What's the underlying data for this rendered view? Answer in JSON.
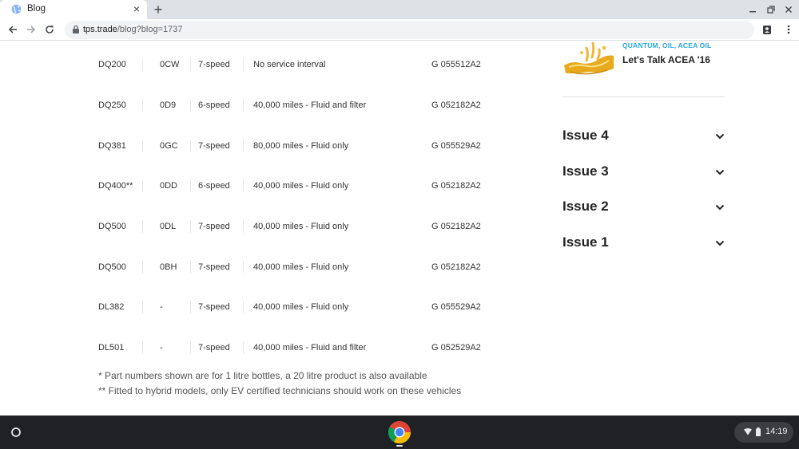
{
  "browser": {
    "tab_title": "Blog",
    "tab_close": "×",
    "new_tab": "+",
    "url_host": "tps.trade",
    "url_path": "/blog?blog=1737",
    "icons": [
      "favicon-globe-icon",
      "back-arrow-icon",
      "forward-arrow-icon",
      "reload-icon",
      "lock-icon",
      "profile-icon",
      "menu-dots-icon",
      "minimize-icon",
      "restore-icon",
      "close-window-icon"
    ]
  },
  "table": {
    "rows": [
      {
        "model": "DQ200",
        "code": "0CW",
        "speed": "7-speed",
        "service": "No service interval",
        "part": "G 055512A2"
      },
      {
        "model": "DQ250",
        "code": "0D9",
        "speed": "6-speed",
        "service": "40,000 miles - Fluid and filter",
        "part": "G 052182A2"
      },
      {
        "model": "DQ381",
        "code": "0GC",
        "speed": "7-speed",
        "service": "80,000 miles - Fluid only",
        "part": "G 055529A2"
      },
      {
        "model": "DQ400**",
        "code": "0DD",
        "speed": "6-speed",
        "service": "40,000 miles - Fluid only",
        "part": "G 052182A2"
      },
      {
        "model": "DQ500",
        "code": "0DL",
        "speed": "7-speed",
        "service": "40,000 miles - Fluid only",
        "part": "G 052182A2"
      },
      {
        "model": "DQ500",
        "code": "0BH",
        "speed": "7-speed",
        "service": "40,000 miles - Fluid only",
        "part": "G 052182A2"
      },
      {
        "model": "DL382",
        "code": "-",
        "speed": "7-speed",
        "service": "40,000 miles - Fluid only",
        "part": "G 055529A2"
      },
      {
        "model": "DL501",
        "code": "-",
        "speed": "7-speed",
        "service": "40,000 miles - Fluid and filter",
        "part": "G 052529A2"
      }
    ]
  },
  "footnotes": {
    "note1": "* Part numbers shown are for 1 litre bottles, a 20 litre product is also available",
    "note2": "** Fitted to hybrid models, only EV certified technicians should work on these vehicles"
  },
  "sidebar": {
    "post_tags": "QUANTUM, OIL, ACEA OIL",
    "post_title": "Let's Talk ACEA '16",
    "issues": [
      {
        "label": "Issue 4"
      },
      {
        "label": "Issue 3"
      },
      {
        "label": "Issue 2"
      },
      {
        "label": "Issue 1"
      }
    ]
  },
  "shelf": {
    "clock": "14:19"
  },
  "colors": {
    "accent_tag": "#2aa6df",
    "shelf_bg": "#202124",
    "tab_strip": "#dee1e6"
  }
}
